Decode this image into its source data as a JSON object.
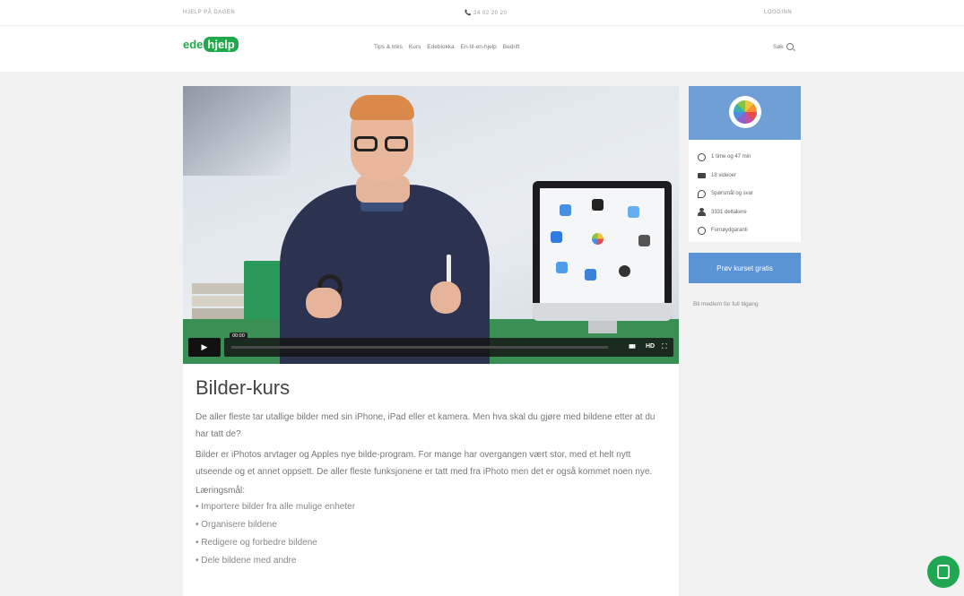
{
  "topbar": {
    "left": "HJELP PÅ DAGEN",
    "phone": "📞 24 02 20 20",
    "login": "LOGGINN"
  },
  "brand": {
    "part1": "ede",
    "part2": "hjelp"
  },
  "nav": {
    "links": [
      "Tips & triks",
      "Kurs",
      "Edeblokka",
      "En-til-en-hjelp",
      "Bedrift"
    ],
    "search_label": "Søk"
  },
  "video": {
    "time": "00:00",
    "progress": 0,
    "hd_label": "HD",
    "volume_label": "▮▮▮",
    "fullscreen_label": "⛶",
    "play_label": "▶"
  },
  "course": {
    "title": "Bilder-kurs",
    "intro": "De aller fleste tar utallige bilder med sin iPhone, iPad eller et kamera. Men hva skal du gjøre med bildene etter at du har tatt de?",
    "body": "Bilder er iPhotos arvtager og Apples nye bilde-program. For mange har overgangen vært stor, med et helt nytt utseende og et annet oppsett. De aller fleste funksjonene er tatt med fra iPhoto men det er også kommet noen nye.",
    "goals_heading": "Læringsmål:",
    "goals": [
      "• Importere bilder fra alle mulige enheter",
      "• Organisere bildene",
      "• Redigere og forbedre bildene",
      "• Dele bildene med andre"
    ]
  },
  "sidebar": {
    "meta": [
      {
        "icon": "clock-icon",
        "text": "1 time og 47 min"
      },
      {
        "icon": "video-icon",
        "text": "18 videoer"
      },
      {
        "icon": "chat-icon",
        "text": "Spørsmål og svar"
      },
      {
        "icon": "user-icon",
        "text": "3331 deltakere"
      },
      {
        "icon": "shield-icon",
        "text": "Fornøydgaranti"
      }
    ],
    "cta_label": "Prøv kurset gratis",
    "member_note": "Bli medlem for full tilgang"
  },
  "colors": {
    "brand_green": "#22a84c",
    "accent_blue": "#5b94d6",
    "card_header_blue": "#6f9fd4"
  }
}
